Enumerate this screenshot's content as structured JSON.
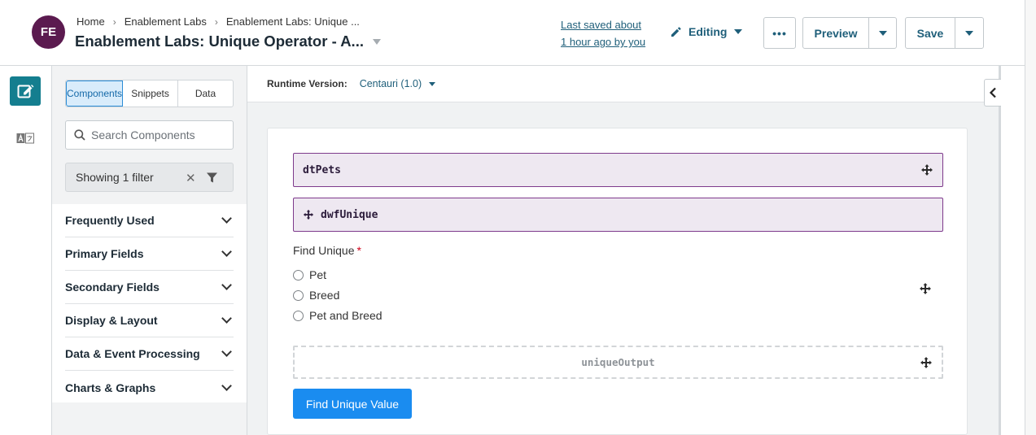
{
  "header": {
    "avatar_initials": "FE",
    "breadcrumb": [
      "Home",
      "Enablement Labs",
      "Enablement Labs: Unique ..."
    ],
    "title": "Enablement Labs: Unique Operator - A...",
    "last_saved_line1": "Last saved about",
    "last_saved_line2": "1 hour ago by you",
    "mode_label": "Editing",
    "more_label": "•••",
    "preview_label": "Preview",
    "save_label": "Save"
  },
  "sidebar": {
    "tabs": [
      {
        "label": "Components",
        "active": true
      },
      {
        "label": "Snippets",
        "active": false
      },
      {
        "label": "Data",
        "active": false
      }
    ],
    "search_placeholder": "Search Components",
    "filter_text": "Showing 1 filter",
    "categories": [
      "Frequently Used",
      "Primary Fields",
      "Secondary Fields",
      "Display & Layout",
      "Data & Event Processing",
      "Charts & Graphs"
    ]
  },
  "main": {
    "runtime_label": "Runtime Version:",
    "runtime_value": "Centauri (1.0)",
    "components": {
      "data_table": "dtPets",
      "workflow": "dwfUnique",
      "field_label": "Find Unique",
      "required_marker": "*",
      "radio_options": [
        "Pet",
        "Breed",
        "Pet and Breed"
      ],
      "output": "uniqueOutput",
      "button_label": "Find Unique Value"
    }
  },
  "colors": {
    "brand_teal": "#147e8f",
    "avatar": "#5b1a4f",
    "primary_button": "#1a8cf0",
    "component_border": "#7e3a8c",
    "required": "#d0021b"
  }
}
